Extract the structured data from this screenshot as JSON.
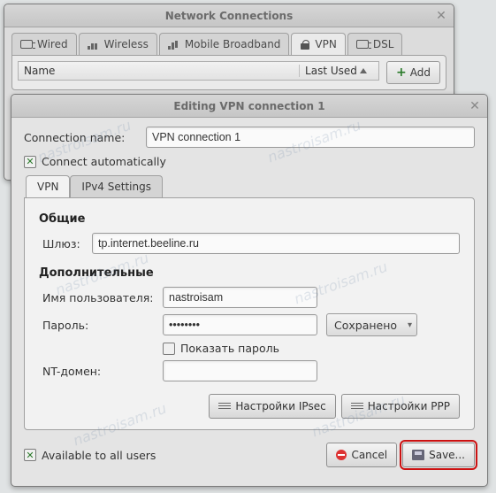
{
  "parent_window": {
    "title": "Network Connections",
    "tabs": [
      {
        "label": "Wired",
        "icon": "plug"
      },
      {
        "label": "Wireless",
        "icon": "signal"
      },
      {
        "label": "Mobile Broadband",
        "icon": "signal"
      },
      {
        "label": "VPN",
        "icon": "lock",
        "active": true
      },
      {
        "label": "DSL",
        "icon": "plug"
      }
    ],
    "list": {
      "col1": "Name",
      "col2": "Last Used"
    },
    "add_label": "Add"
  },
  "dialog": {
    "title": "Editing VPN connection 1",
    "connection_name_label": "Connection name:",
    "connection_name_value": "VPN connection 1",
    "connect_auto_label": "Connect automatically",
    "subtabs": [
      "VPN",
      "IPv4 Settings"
    ],
    "section_general": "Общие",
    "gateway_label": "Шлюз:",
    "gateway_value": "tp.internet.beeline.ru",
    "section_extra": "Дополнительные",
    "user_label": "Имя пользователя:",
    "user_value": "nastroisam",
    "password_label": "Пароль:",
    "password_value": "••••••••",
    "password_select": "Сохранено",
    "show_password_label": "Показать пароль",
    "ntdomain_label": "NT-домен:",
    "ntdomain_value": "",
    "ipsec_btn": "Настройки IPsec",
    "ppp_btn": "Настройки PPP",
    "available_label": "Available to all users",
    "cancel_label": "Cancel",
    "save_label": "Save..."
  },
  "watermark": "nastroisam.ru"
}
